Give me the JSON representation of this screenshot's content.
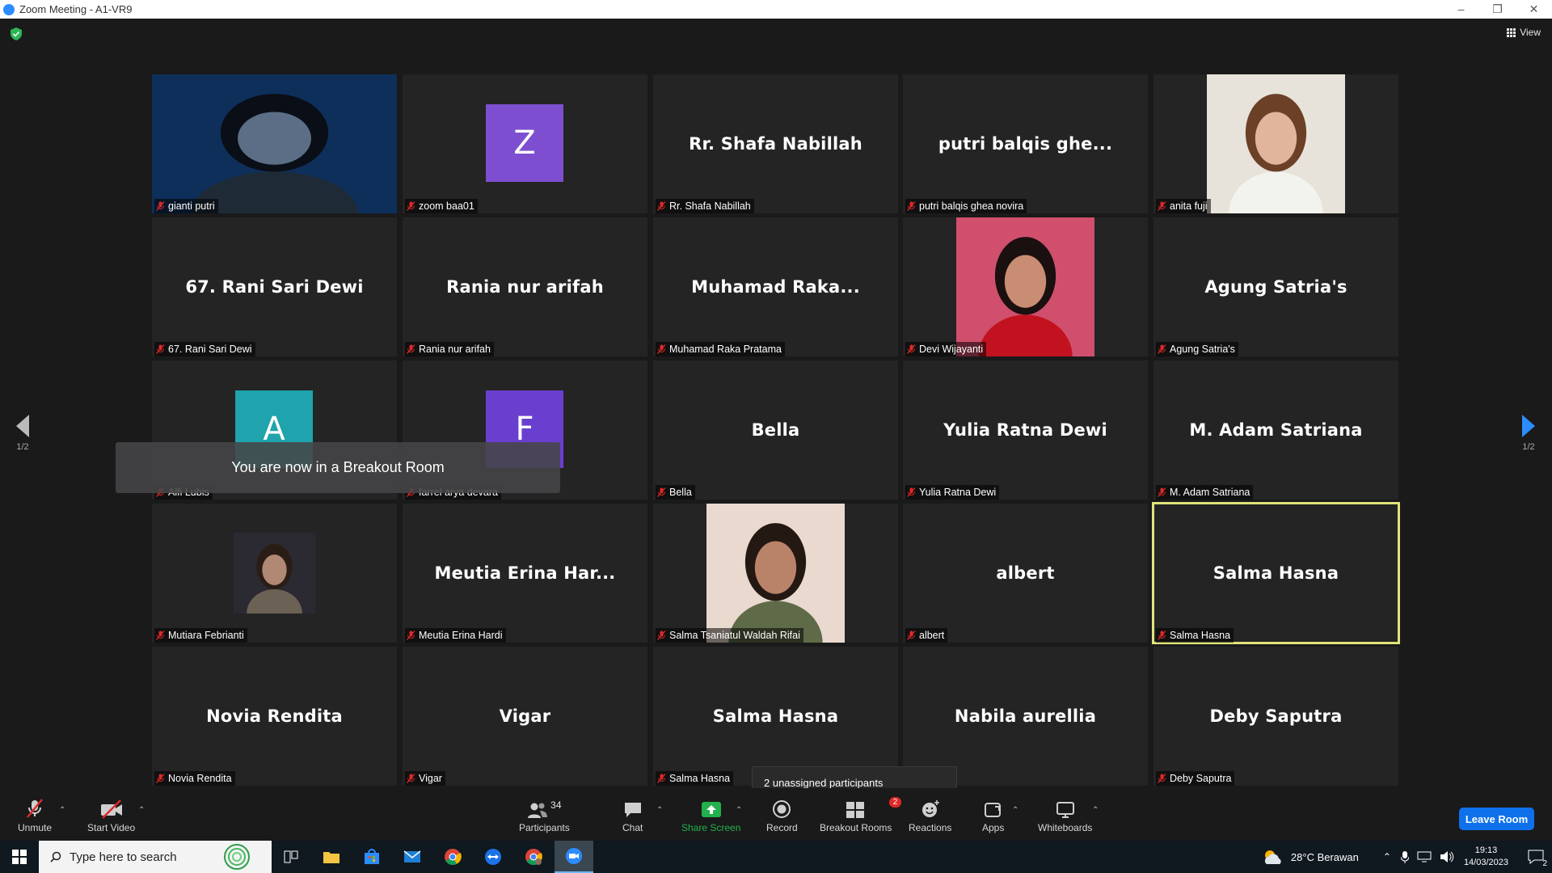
{
  "window": {
    "title": "Zoom Meeting - A1-VR9"
  },
  "view_label": "View",
  "pagination": {
    "left": "1/2",
    "right": "1/2"
  },
  "toast": "You are now in a Breakout Room",
  "tooltip": "2 unassigned participants",
  "tiles": [
    {
      "display": "",
      "label": "gianti putri",
      "type": "photo"
    },
    {
      "display": "Z",
      "label": "zoom baa01",
      "type": "avatar",
      "color": "#7d4fd0"
    },
    {
      "display": "Rr. Shafa Nabillah",
      "label": "Rr. Shafa Nabillah",
      "type": "name"
    },
    {
      "display": "putri balqis ghe...",
      "label": "putri balqis ghea novira",
      "type": "name"
    },
    {
      "display": "",
      "label": "anita fuji",
      "type": "photo"
    },
    {
      "display": "67. Rani Sari Dewi",
      "label": "67. Rani Sari Dewi",
      "type": "name"
    },
    {
      "display": "Rania nur arifah",
      "label": "Rania nur arifah",
      "type": "name"
    },
    {
      "display": "Muhamad  Raka...",
      "label": "Muhamad Raka Pratama",
      "type": "name"
    },
    {
      "display": "",
      "label": "Devi Wijayanti",
      "type": "photo"
    },
    {
      "display": "Agung Satria's",
      "label": "Agung Satria's",
      "type": "name"
    },
    {
      "display": "A",
      "label": "Alfi Lubis",
      "type": "avatar",
      "color": "#1fa3ac"
    },
    {
      "display": "F",
      "label": "farrel arya devara",
      "type": "avatar",
      "color": "#6a3fcf"
    },
    {
      "display": "Bella",
      "label": "Bella",
      "type": "name"
    },
    {
      "display": "Yulia Ratna Dewi",
      "label": "Yulia Ratna Dewi",
      "type": "name"
    },
    {
      "display": "M. Adam Satriana",
      "label": "M. Adam Satriana",
      "type": "name"
    },
    {
      "display": "",
      "label": "Mutiara Febrianti",
      "type": "photo"
    },
    {
      "display": "Meutia Erina Har...",
      "label": "Meutia Erina Hardi",
      "type": "name"
    },
    {
      "display": "",
      "label": "Salma Tsaniatul Waldah Rifai",
      "type": "photo"
    },
    {
      "display": "albert",
      "label": "albert",
      "type": "name"
    },
    {
      "display": "Salma Hasna",
      "label": "Salma Hasna",
      "type": "name",
      "active": true
    },
    {
      "display": "Novia Rendita",
      "label": "Novia Rendita",
      "type": "name"
    },
    {
      "display": "Vigar",
      "label": "Vigar",
      "type": "name"
    },
    {
      "display": "Salma Hasna",
      "label": "Salma Hasna",
      "type": "name"
    },
    {
      "display": "Nabila aurellia",
      "label": "urellia",
      "type": "name"
    },
    {
      "display": "Deby Saputra",
      "label": "Deby Saputra",
      "type": "name"
    }
  ],
  "toolbar": {
    "unmute": "Unmute",
    "start_video": "Start Video",
    "participants": "Participants",
    "participants_count": "34",
    "chat": "Chat",
    "share_screen": "Share Screen",
    "record": "Record",
    "breakout_rooms": "Breakout Rooms",
    "breakout_badge": "2",
    "reactions": "Reactions",
    "apps": "Apps",
    "whiteboards": "Whiteboards",
    "leave": "Leave Room"
  },
  "taskbar": {
    "search_placeholder": "Type here to search",
    "weather": "28°C  Berawan",
    "time": "19:13",
    "date": "14/03/2023",
    "notifications": "2"
  },
  "colors": {
    "accent": "#0e71eb",
    "share_green": "#22b14c",
    "active_border": "#dfe37a",
    "mute_red": "#e02828"
  }
}
